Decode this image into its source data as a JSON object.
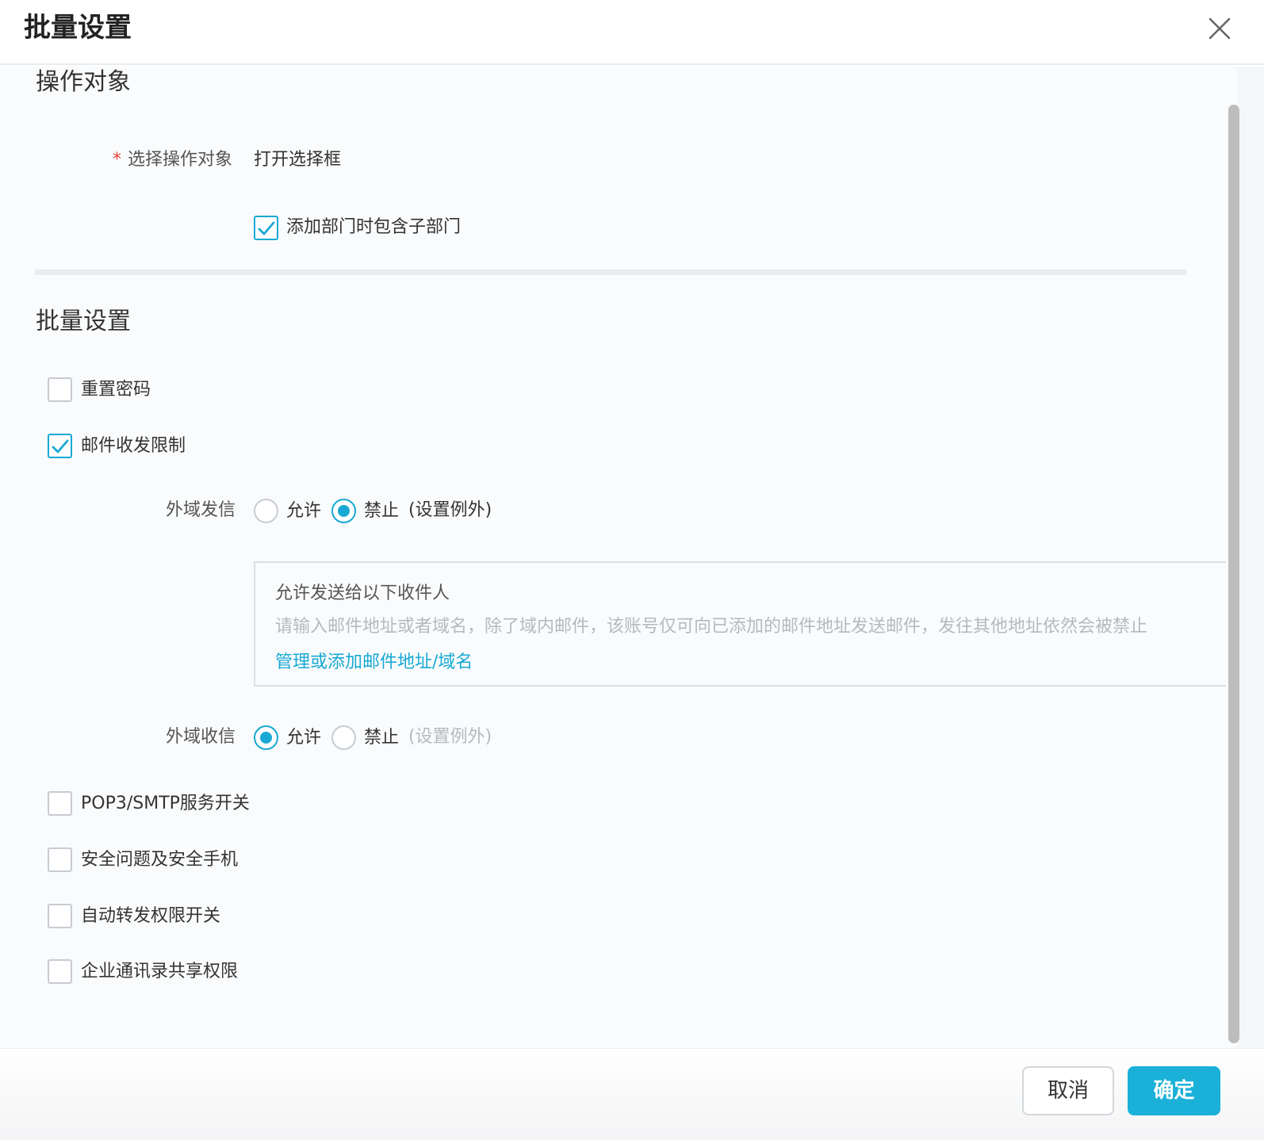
{
  "dialog": {
    "title": "批量设置",
    "close_icon": "close-icon"
  },
  "target_section": {
    "title": "操作对象",
    "required_mark": "*",
    "select_label": "选择操作对象",
    "open_selector_link": "打开选择框",
    "include_sub_departments": {
      "label": "添加部门时包含子部门",
      "checked": true
    }
  },
  "batch_section": {
    "title": "批量设置",
    "reset_password": {
      "label": "重置密码",
      "checked": false
    },
    "mail_restriction": {
      "label": "邮件收发限制",
      "checked": true
    },
    "external_send": {
      "label": "外域发信",
      "options": [
        "允许",
        "禁止"
      ],
      "selected": "禁止",
      "exception_link": "(设置例外)"
    },
    "exception_box": {
      "title": "允许发送给以下收件人",
      "hint": "请输入邮件地址或者域名，除了域内邮件，该账号仅可向已添加的邮件地址发送邮件，发往其他地址依然会被禁止",
      "manage_link": "管理或添加邮件地址/域名"
    },
    "external_receive": {
      "label": "外域收信",
      "options": [
        "允许",
        "禁止"
      ],
      "selected": "允许",
      "exception_link": "(设置例外)"
    },
    "pop3_smtp": {
      "label": "POP3/SMTP服务开关",
      "checked": false
    },
    "security_question": {
      "label": "安全问题及安全手机",
      "checked": false
    },
    "auto_forward": {
      "label": "自动转发权限开关",
      "checked": false
    },
    "address_book_share": {
      "label": "企业通讯录共享权限",
      "checked": false
    }
  },
  "footer": {
    "cancel_label": "取消",
    "ok_label": "确定"
  },
  "colors": {
    "accent": "#18a9d4",
    "required": "#e8433b",
    "primary_button": "#1ab0d8"
  }
}
